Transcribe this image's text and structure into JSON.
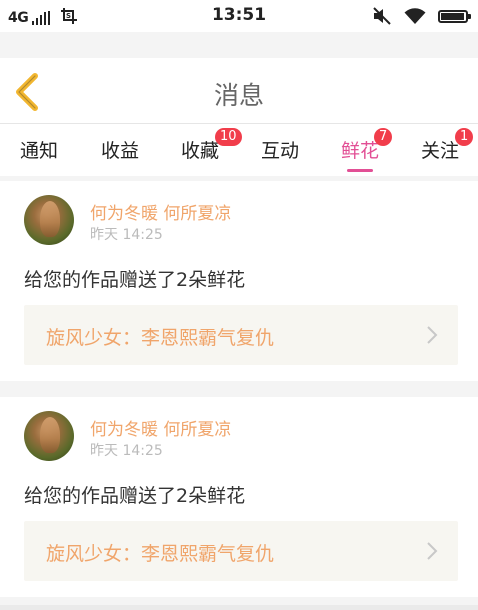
{
  "status_bar": {
    "network": "4G",
    "signal_level": 5,
    "time": "13:51",
    "battery_level": 0.96,
    "icons": [
      "signal-icon",
      "screenshot-crop-icon",
      "mute-icon",
      "wifi-icon",
      "battery-icon"
    ]
  },
  "header": {
    "title": "消息",
    "back_icon": "chevron-left-icon",
    "back_color": "#f2b630"
  },
  "tabs": [
    {
      "label": "通知",
      "badge": "",
      "active": false
    },
    {
      "label": "收益",
      "badge": "",
      "active": false
    },
    {
      "label": "收藏",
      "badge": "10",
      "active": false
    },
    {
      "label": "互动",
      "badge": "",
      "active": false
    },
    {
      "label": "鲜花",
      "badge": "7",
      "active": true
    },
    {
      "label": "关注",
      "badge": "1",
      "active": false
    }
  ],
  "colors": {
    "active_tab": "#e24f95",
    "badge": "#f13d4b",
    "username": "#f0a56b",
    "work_title": "#f0a56b"
  },
  "messages": [
    {
      "username": "何为冬暖 何所夏凉",
      "time": "昨天 14:25",
      "text": "给您的作品赠送了2朵鲜花",
      "work": "旋风少女：李恩熙霸气复仇"
    },
    {
      "username": "何为冬暖 何所夏凉",
      "time": "昨天 14:25",
      "text": "给您的作品赠送了2朵鲜花",
      "work": "旋风少女：李恩熙霸气复仇"
    }
  ]
}
